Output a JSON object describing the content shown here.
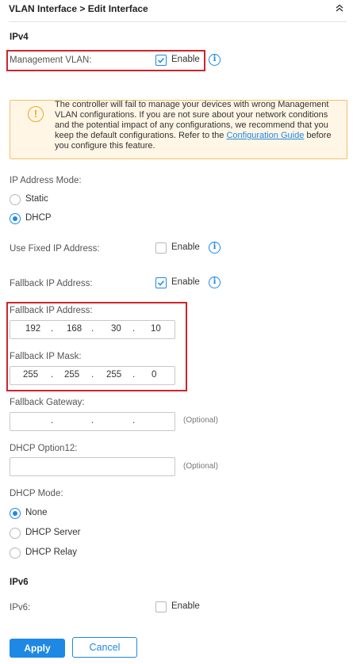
{
  "header": {
    "breadcrumb": "VLAN Interface > Edit Interface"
  },
  "ipv4": {
    "section_title": "IPv4",
    "management_vlan": {
      "label": "Management VLAN:",
      "checkbox_label": "Enable",
      "checked": true
    },
    "warning": {
      "text_before_link": "The controller will fail to manage your devices with wrong Management VLAN configurations. If you are not sure about your network conditions and the potential impact of any configurations, we recommend that you keep the default configurations. Refer to the ",
      "link_text": "Configuration Guide",
      "text_after_link": " before you configure this feature."
    },
    "ip_address_mode": {
      "label": "IP Address Mode:",
      "options": [
        "Static",
        "DHCP"
      ],
      "selected": "DHCP"
    },
    "use_fixed_ip": {
      "label": "Use Fixed IP Address:",
      "checkbox_label": "Enable",
      "checked": false
    },
    "fallback_ip_toggle": {
      "label": "Fallback IP Address:",
      "checkbox_label": "Enable",
      "checked": true
    },
    "fallback_ip_address": {
      "label": "Fallback IP Address:",
      "octets": [
        "192",
        "168",
        "30",
        "10"
      ],
      "separator": "."
    },
    "fallback_ip_mask": {
      "label": "Fallback IP Mask:",
      "octets": [
        "255",
        "255",
        "255",
        "0"
      ],
      "separator": "."
    },
    "fallback_gateway": {
      "label": "Fallback Gateway:",
      "octets": [
        "",
        "",
        "",
        ""
      ],
      "separator": ".",
      "hint": "(Optional)"
    },
    "dhcp_option12": {
      "label": "DHCP Option12:",
      "value": "",
      "hint": "(Optional)"
    },
    "dhcp_mode": {
      "label": "DHCP Mode:",
      "options": [
        "None",
        "DHCP Server",
        "DHCP Relay"
      ],
      "selected": "None"
    }
  },
  "ipv6": {
    "section_title": "IPv6",
    "toggle": {
      "label": "IPv6:",
      "checkbox_label": "Enable",
      "checked": false
    }
  },
  "actions": {
    "apply_label": "Apply",
    "cancel_label": "Cancel"
  },
  "colors": {
    "accent": "#1e88e5",
    "highlight_border": "#d0242b",
    "warning_bg": "#fff6e6",
    "warning_border": "#f3c069"
  },
  "icons": {
    "collapse": "double-chevron-up-icon",
    "info": "info-circle-icon",
    "warning": "exclamation-circle-icon",
    "check": "checkmark-icon"
  }
}
